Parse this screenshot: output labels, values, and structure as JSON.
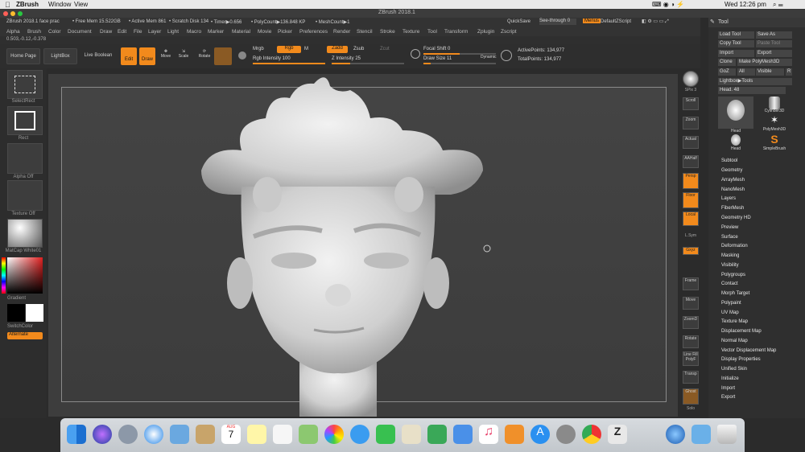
{
  "mac_menu": {
    "apple": "",
    "app": "ZBrush",
    "items": [
      "Window",
      "View"
    ],
    "clock": "Wed 12:26 pm"
  },
  "window": {
    "title": "ZBrush 2018.1"
  },
  "infobar": {
    "doc": "ZBrush 2018.1 face prac",
    "free_mem": "• Free Mem 15.522GB",
    "active_mem": "• Active Mem 861",
    "scratch": "• Scratch Disk 134",
    "timer": "• Timer▶0.656",
    "polycount": "• PolyCount▶136.848 KP",
    "meshcount": "• MeshCount▶1",
    "quicksave": "QuickSave",
    "seethrough": "See-through",
    "seethrough_val": "0",
    "menus": "Menus",
    "script": "DefaultZScript"
  },
  "menubar": [
    "Alpha",
    "Brush",
    "Color",
    "Document",
    "Draw",
    "Edit",
    "File",
    "Layer",
    "Light",
    "Macro",
    "Marker",
    "Material",
    "Movie",
    "Picker",
    "Preferences",
    "Render",
    "Stencil",
    "Stroke",
    "Texture",
    "Tool",
    "Transform",
    "Zplugin",
    "Zscript"
  ],
  "coords": "0.503,-0.12,-0.378",
  "toolbar": {
    "home": "Home Page",
    "lightbox": "LightBox",
    "livebool": "Live Boolean",
    "edit": "Edit",
    "draw": "Draw",
    "move": "Move",
    "scale": "Scale",
    "rotate": "Rotate",
    "mrgb": "Mrgb",
    "rgb": "Rgb",
    "m": "M",
    "zadd": "Zadd",
    "zsub": "Zsub",
    "zcut": "Zcut",
    "rgb_intensity": "Rgb Intensity 100",
    "z_intensity": "Z Intensity 25",
    "z_intensity_value": 25,
    "rgb_intensity_value": 100,
    "focal": "Focal Shift 0",
    "drawsize": "Draw Size 11",
    "dynamic": "Dynamic",
    "activepoints": "ActivePoints: 134,977",
    "totalpoints": "TotalPoints: 134,977"
  },
  "leftshelf": {
    "selectrect": "SelectRect",
    "rect": "Rect",
    "alpha": "Alpha Off",
    "texture": "Texture Off",
    "matcap": "MatCap White01",
    "gradient": "Gradient",
    "switchcolor": "SwitchColor",
    "alternate": "Alternate"
  },
  "rightshelf": [
    "BPR",
    "SPix 3",
    "Scroll",
    "Zoom",
    "Actual",
    "AAHalf",
    "Persp",
    "Floor",
    "Local",
    "L.Sym",
    "Gxyz",
    "Frame",
    "Move",
    "ZoomD",
    "Rotate",
    "Line Fill PolyF",
    "Transp",
    "Ghost",
    "Solo",
    "Xpose"
  ],
  "toolpanel": {
    "title": "Tool",
    "buttons": [
      "Load Tool",
      "Save As",
      "Copy Tool",
      "Paste Tool",
      "Import",
      "Export",
      "Clone",
      "Make PolyMesh3D",
      "GoZ",
      "All",
      "Visible",
      "R"
    ],
    "lightbox_tools": "Lightbox▶Tools",
    "head_label": "Head. 48",
    "thumbs": [
      "Head",
      "Cylinder3D",
      "PolyMesh3D",
      "Head",
      "SimpleBrush"
    ],
    "sections": [
      "Subtool",
      "Geometry",
      "ArrayMesh",
      "NanoMesh",
      "Layers",
      "FiberMesh",
      "Geometry HD",
      "Preview",
      "Surface",
      "Deformation",
      "Masking",
      "Visibility",
      "Polygroups",
      "Contact",
      "Morph Target",
      "Polypaint",
      "UV Map",
      "Texture Map",
      "Displacement Map",
      "Normal Map",
      "Vector Displacement Map",
      "Display Properties",
      "Unified Skin",
      "Initialize",
      "Import",
      "Export"
    ]
  },
  "dock": {
    "apps": [
      "Finder",
      "Siri",
      "Launchpad",
      "Safari",
      "Mail",
      "Notes",
      "Calendar",
      "Stickies",
      "Reminders",
      "Maps",
      "Photos",
      "Messages",
      "FaceTime",
      "Preview",
      "Numbers",
      "Keynote",
      "iTunes",
      "iBooks",
      "App Store",
      "System Preferences",
      "Chrome",
      "ZBrush",
      "Network",
      "Downloads",
      "Trash"
    ],
    "calendar_day": "7",
    "calendar_month": "AUG"
  },
  "colors": {
    "accent": "#f28a1c",
    "panel": "#2f2f2f",
    "canvas": "#3d3d3d"
  }
}
